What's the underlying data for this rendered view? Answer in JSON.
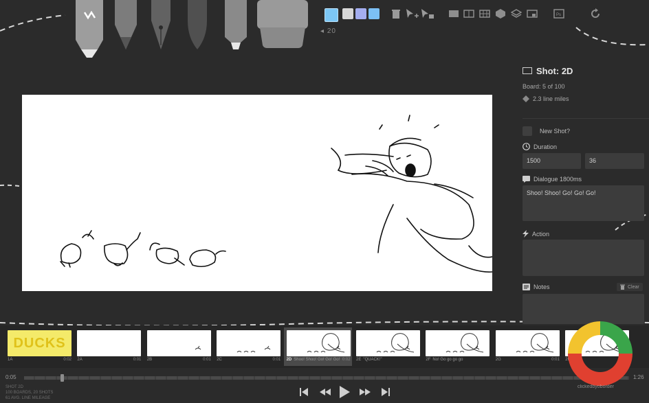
{
  "toolbar": {
    "brush_size": "20",
    "swatch_colors": [
      "#7cc7f5",
      "#d8d8d8",
      "#a4aef0",
      "#7cc0f5"
    ]
  },
  "inspector": {
    "shot_title": "Shot: 2D",
    "board_info": "Board: 5 of 100",
    "line_miles": "2.3 line miles",
    "new_shot_label": "New Shot?",
    "duration_label": "Duration",
    "duration_ms": "1500",
    "duration_frames": "36",
    "dialogue_label": "Dialogue 1800ms",
    "dialogue_text": "Shoo! Shoo! Go! Go! Go!",
    "action_label": "Action",
    "notes_label": "Notes",
    "clear_label": "Clear"
  },
  "timeline": {
    "boards": [
      {
        "id": "1A",
        "label": "",
        "dur": "0:02",
        "title_text": "DUCKS"
      },
      {
        "id": "2A",
        "label": "",
        "dur": "0:01"
      },
      {
        "id": "2B",
        "label": "",
        "dur": "0:01"
      },
      {
        "id": "2C",
        "label": "",
        "dur": "0:01"
      },
      {
        "id": "2D",
        "label": "Shoo! Shoo! Go! Go! Go!",
        "dur": "0:02"
      },
      {
        "id": "2E",
        "label": "\"QUACK!\"",
        "dur": ""
      },
      {
        "id": "2F",
        "label": "No! Go go go go",
        "dur": ""
      },
      {
        "id": "2G",
        "label": "",
        "dur": "0:01"
      },
      {
        "id": "2H",
        "label": "",
        "dur": ""
      }
    ],
    "time_start": "0:05",
    "time_end": "1:26",
    "progress": 0.06,
    "summary_shot": "SHOT 2D",
    "summary_boards": "100 BOARDS, 20 SHOTS",
    "summary_mileage": "61 AVG. LINE MILEAGE"
  },
  "watermark": "clickedbyoborder"
}
